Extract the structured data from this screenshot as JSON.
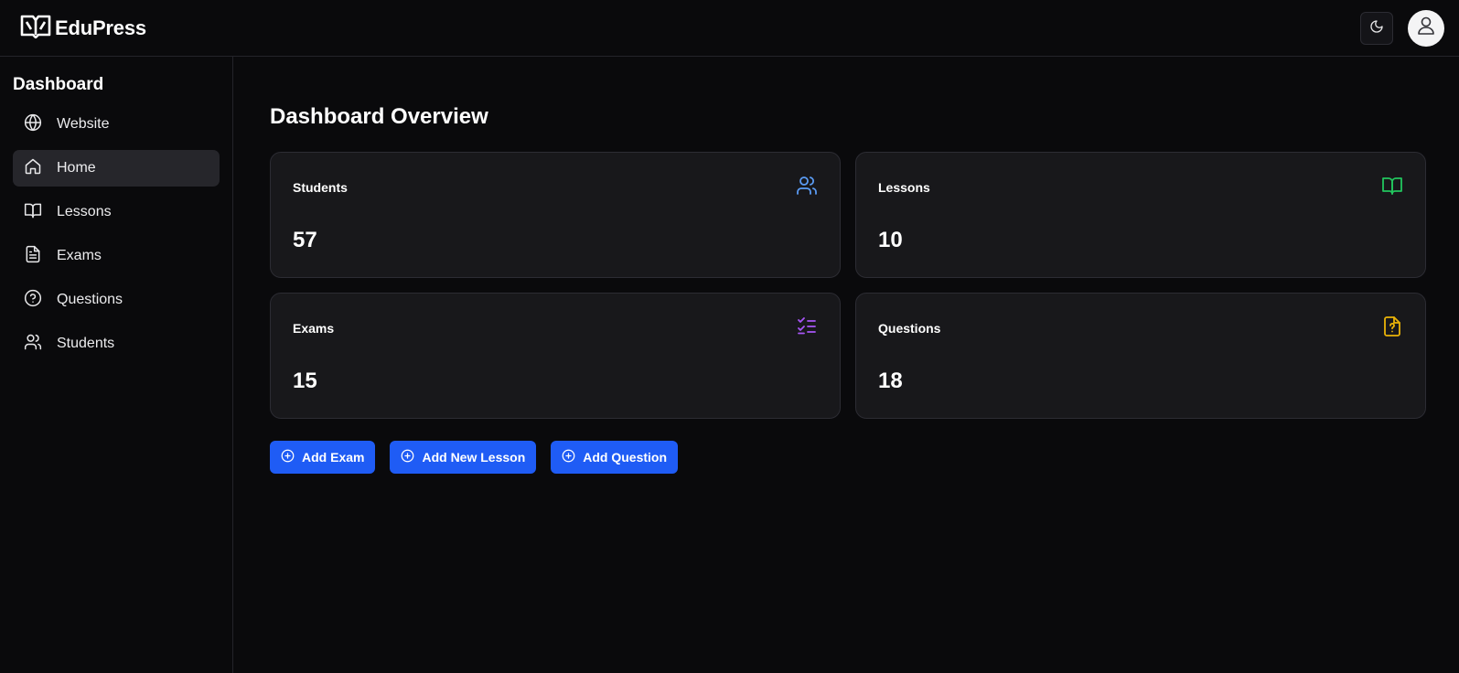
{
  "brand": {
    "name": "EduPress"
  },
  "header": {
    "theme_icon": "moon-icon",
    "avatar_icon": "user-icon"
  },
  "sidebar": {
    "title": "Dashboard",
    "items": [
      {
        "label": "Website",
        "icon": "globe-icon",
        "active": false
      },
      {
        "label": "Home",
        "icon": "home-icon",
        "active": true
      },
      {
        "label": "Lessons",
        "icon": "book-open-icon",
        "active": false
      },
      {
        "label": "Exams",
        "icon": "file-text-icon",
        "active": false
      },
      {
        "label": "Questions",
        "icon": "help-circle-icon",
        "active": false
      },
      {
        "label": "Students",
        "icon": "users-icon",
        "active": false
      }
    ]
  },
  "main": {
    "title": "Dashboard Overview",
    "cards": [
      {
        "label": "Students",
        "value": "57",
        "icon": "users-icon",
        "color": "#5b9cf5"
      },
      {
        "label": "Lessons",
        "value": "10",
        "icon": "book-open-icon",
        "color": "#22c55e"
      },
      {
        "label": "Exams",
        "value": "15",
        "icon": "list-checks-icon",
        "color": "#a855f7"
      },
      {
        "label": "Questions",
        "value": "18",
        "icon": "file-question-icon",
        "color": "#eab308"
      }
    ],
    "actions": [
      {
        "label": "Add Exam",
        "icon": "plus-circle-icon"
      },
      {
        "label": "Add New Lesson",
        "icon": "plus-circle-icon"
      },
      {
        "label": "Add Question",
        "icon": "plus-circle-icon"
      }
    ]
  },
  "colors": {
    "accent": "#1f5cf5",
    "background": "#0a0a0c",
    "card": "#18181b"
  }
}
